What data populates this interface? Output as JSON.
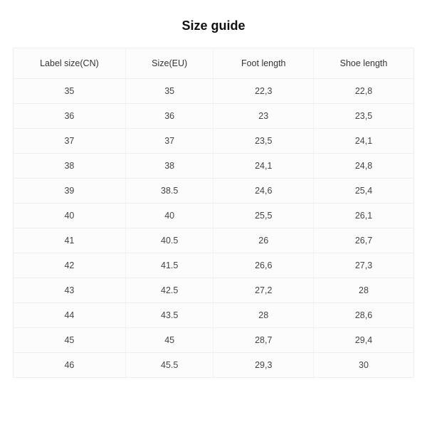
{
  "title": "Size guide",
  "chart_data": {
    "type": "table",
    "columns": [
      "Label size(CN)",
      "Size(EU)",
      "Foot length",
      "Shoe length"
    ],
    "rows": [
      [
        "35",
        "35",
        "22,3",
        "22,8"
      ],
      [
        "36",
        "36",
        "23",
        "23,5"
      ],
      [
        "37",
        "37",
        "23,5",
        "24,1"
      ],
      [
        "38",
        "38",
        "24,1",
        "24,8"
      ],
      [
        "39",
        "38.5",
        "24,6",
        "25,4"
      ],
      [
        "40",
        "40",
        "25,5",
        "26,1"
      ],
      [
        "41",
        "40.5",
        "26",
        "26,7"
      ],
      [
        "42",
        "41.5",
        "26,6",
        "27,3"
      ],
      [
        "43",
        "42.5",
        "27,2",
        "28"
      ],
      [
        "44",
        "43.5",
        "28",
        "28,6"
      ],
      [
        "45",
        "45",
        "28,7",
        "29,4"
      ],
      [
        "46",
        "45.5",
        "29,3",
        "30"
      ]
    ]
  }
}
